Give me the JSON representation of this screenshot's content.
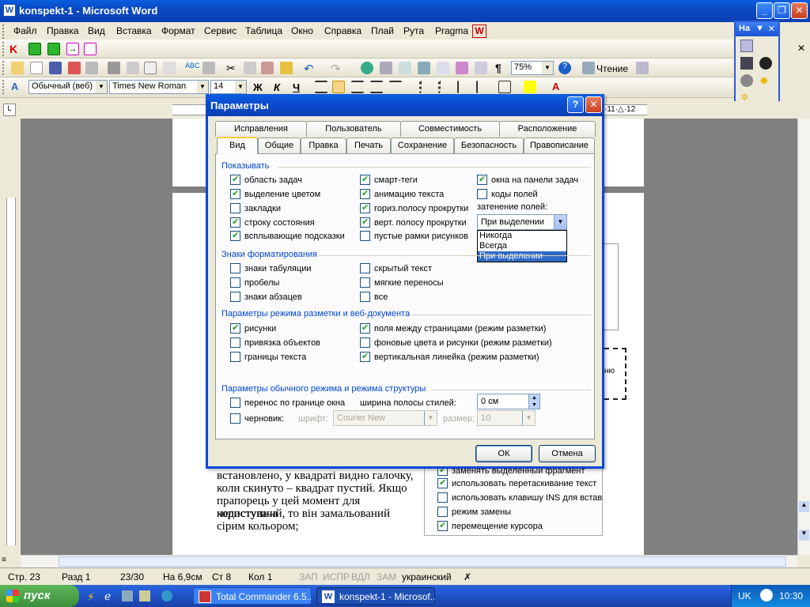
{
  "window": {
    "title": "konspekt-1 - Microsoft Word",
    "minimize": "_",
    "maximize": "❐",
    "close": "✕"
  },
  "menu": [
    "Файл",
    "Правка",
    "Вид",
    "Вставка",
    "Формат",
    "Сервис",
    "Таблица",
    "Окно",
    "Справка",
    "Плай",
    "Рута",
    "Pragma"
  ],
  "close_doc": "✕",
  "toolbar": {
    "zoom": "75%",
    "reading": "Чтение"
  },
  "formatting": {
    "style": "Обычный (веб)",
    "font": "Times New Roman",
    "size": "14",
    "bold": "Ж",
    "italic": "К",
    "underline": "Ч"
  },
  "float_toolbar": {
    "title": "На"
  },
  "ruler": {
    "right_marks": "·11·△·12"
  },
  "dialog": {
    "title": "Параметры",
    "help": "?",
    "close": "✕",
    "tabs_back": [
      "Исправления",
      "Пользователь",
      "Совместимость",
      "Расположение"
    ],
    "tabs_front": [
      "Вид",
      "Общие",
      "Правка",
      "Печать",
      "Сохранение",
      "Безопасность",
      "Правописание"
    ],
    "groups": {
      "show": "Показывать",
      "formatting_marks": "Знаки форматирования",
      "layout_web": "Параметры режима разметки и веб-документа",
      "normal_outline": "Параметры обычного режима и режима структуры"
    },
    "show_col1": [
      {
        "label": "область задач",
        "checked": true
      },
      {
        "label": "выделение цветом",
        "checked": true
      },
      {
        "label": "закладки",
        "checked": false
      },
      {
        "label": "строку состояния",
        "checked": true
      },
      {
        "label": "всплывающие подсказки",
        "checked": true
      }
    ],
    "show_col2": [
      {
        "label": "смарт-теги",
        "checked": true
      },
      {
        "label": "анимацию текста",
        "checked": true
      },
      {
        "label": "гориз.полосу прокрутки",
        "checked": true
      },
      {
        "label": "верт. полосу прокрутки",
        "checked": true
      },
      {
        "label": "пустые рамки рисунков",
        "checked": false
      }
    ],
    "show_col3": [
      {
        "label": "окна на панели задач",
        "checked": true
      },
      {
        "label": "коды полей",
        "checked": false
      }
    ],
    "field_shading_label": "затенение полей:",
    "field_shading_value": "При выделении",
    "field_shading_options": [
      "Никогда",
      "Всегда",
      "При выделении"
    ],
    "fmt_col1": [
      {
        "label": "знаки табуляции",
        "checked": false
      },
      {
        "label": "пробелы",
        "checked": false
      },
      {
        "label": "знаки абзацев",
        "checked": false
      }
    ],
    "fmt_col2": [
      {
        "label": "скрытый текст",
        "checked": false
      },
      {
        "label": "мягкие переносы",
        "checked": false
      },
      {
        "label": "все",
        "checked": false
      }
    ],
    "layout_col1": [
      {
        "label": "рисунки",
        "checked": true
      },
      {
        "label": "привязка объектов",
        "checked": false
      },
      {
        "label": "границы текста",
        "checked": false
      }
    ],
    "layout_col2": [
      {
        "label": "поля между страницами (режим разметки)",
        "checked": true
      },
      {
        "label": "фоновые цвета и рисунки (режим разметки)",
        "checked": false
      },
      {
        "label": "вертикальная линейка (режим разметки)",
        "checked": true
      }
    ],
    "wrap_window": {
      "label": "перенос по границе окна",
      "checked": false
    },
    "draft": {
      "label": "черновик:",
      "checked": false
    },
    "style_width_label": "ширина полосы стилей:",
    "style_width_value": "0 см",
    "font_label": "шрифт:",
    "font_value": "Courier New",
    "size_label": "размер:",
    "size_value": "10",
    "ok": "ОК",
    "cancel": "Отмена"
  },
  "document": {
    "text_lines": [
      "встановлено, у квадраті видно галочку,",
      "коли скинуто – квадрат пустий. Якщо",
      "прапорець у цей момент для користувача",
      "недоступний, то він замальований",
      "сірим кольором;"
    ],
    "bg_checkboxes": [
      {
        "label": "заменять выделенный фрагмент",
        "checked": true
      },
      {
        "label": "использовать перетаскивание текст",
        "checked": true
      },
      {
        "label": "использовать клавишу INS для встав",
        "checked": false
      },
      {
        "label": "режим замены",
        "checked": false
      },
      {
        "label": "перемещение курсора",
        "checked": true
      }
    ],
    "bg_snippet": "ню"
  },
  "status": {
    "page": "Стр. 23",
    "section": "Разд 1",
    "pages": "23/30",
    "at": "На 6,9см",
    "line": "Ст 8",
    "col": "Кол 1",
    "rec": "ЗАП",
    "trk": "ИСПР",
    "ext": "ВДЛ",
    "ovr": "ЗАМ",
    "language": "украинский"
  },
  "taskbar": {
    "start": "пуск",
    "tasks": [
      "Total Commander 6.5...",
      "konspekt-1 - Microsof..."
    ],
    "lang": "UK",
    "clock": "10:30"
  }
}
